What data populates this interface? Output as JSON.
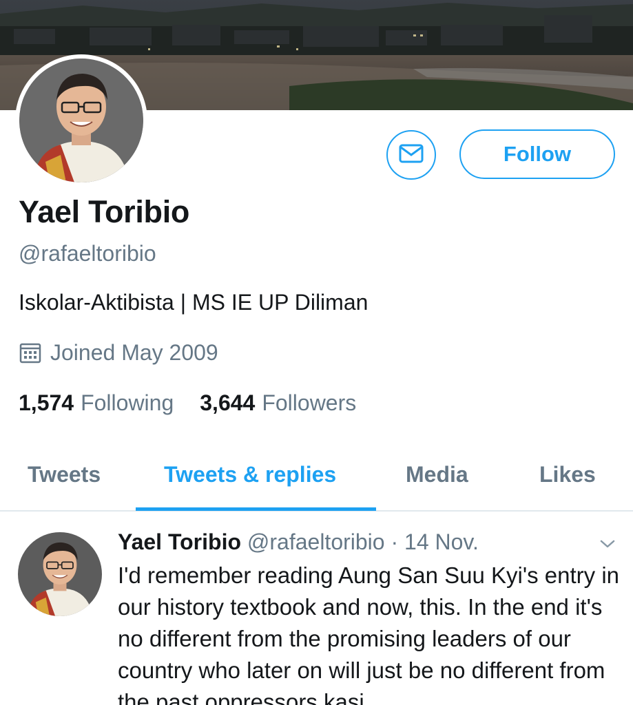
{
  "profile": {
    "name": "Yael Toribio",
    "handle": "@rafaeltoribio",
    "bio": "Iskolar-Aktibista | MS IE UP Diliman",
    "joined": "Joined May 2009",
    "following_count": "1,574",
    "following_label": "Following",
    "followers_count": "3,644",
    "followers_label": "Followers"
  },
  "actions": {
    "message_icon": "envelope-icon",
    "follow_label": "Follow"
  },
  "tabs": [
    {
      "label": "Tweets",
      "active": false
    },
    {
      "label": "Tweets & replies",
      "active": true
    },
    {
      "label": "Media",
      "active": false
    },
    {
      "label": "Likes",
      "active": false
    }
  ],
  "tweet": {
    "name": "Yael Toribio",
    "handle": "@rafaeltoribio",
    "separator": "·",
    "date": "14 Nov.",
    "text": "I'd remember reading Aung San Suu Kyi's entry in our history textbook and now, this. In the end it's no different from the promising leaders of our country who later on will just be no different from the past oppressors kasi"
  },
  "colors": {
    "accent": "#1da1f2",
    "text_primary": "#14171a",
    "text_secondary": "#657786",
    "divider": "#e1e8ed"
  }
}
